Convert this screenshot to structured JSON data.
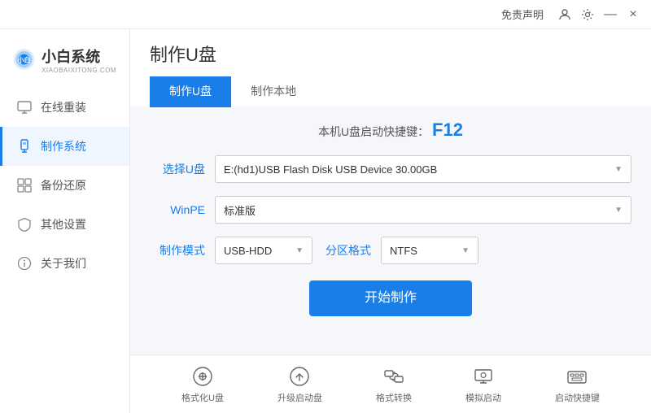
{
  "titlebar": {
    "feedback_label": "免责声明",
    "minimize": "—",
    "close": "×"
  },
  "logo": {
    "title": "小白系统",
    "subtitle": "XIAOBAIXITONG.COM"
  },
  "sidebar": {
    "items": [
      {
        "id": "online-reinstall",
        "label": "在线重装",
        "icon": "monitor"
      },
      {
        "id": "make-system",
        "label": "制作系统",
        "icon": "usb",
        "active": true
      },
      {
        "id": "backup-restore",
        "label": "备份还原",
        "icon": "grid"
      },
      {
        "id": "other-settings",
        "label": "其他设置",
        "icon": "shield"
      },
      {
        "id": "about-us",
        "label": "关于我们",
        "icon": "info"
      }
    ]
  },
  "page": {
    "title": "制作U盘",
    "tabs": [
      {
        "id": "make-usb",
        "label": "制作U盘",
        "active": true
      },
      {
        "id": "make-local",
        "label": "制作本地",
        "active": false
      }
    ]
  },
  "form": {
    "shortcut_prefix": "本机U盘启动快捷键：",
    "shortcut_key": "F12",
    "select_usb_label": "选择U盘",
    "select_usb_value": "E:(hd1)USB Flash Disk USB Device 30.00GB",
    "winpe_label": "WinPE",
    "winpe_value": "标准版",
    "make_mode_label": "制作模式",
    "make_mode_value": "USB-HDD",
    "partition_label": "分区格式",
    "partition_value": "NTFS",
    "start_button": "开始制作"
  },
  "bottom_toolbar": {
    "items": [
      {
        "id": "format-usb",
        "label": "格式化U盘",
        "icon": "format"
      },
      {
        "id": "upgrade-boot",
        "label": "升级启动盘",
        "icon": "upload"
      },
      {
        "id": "format-convert",
        "label": "格式转换",
        "icon": "convert"
      },
      {
        "id": "simulate-boot",
        "label": "模拟启动",
        "icon": "display"
      },
      {
        "id": "boot-shortcut",
        "label": "启动快捷键",
        "icon": "keyboard"
      }
    ]
  }
}
